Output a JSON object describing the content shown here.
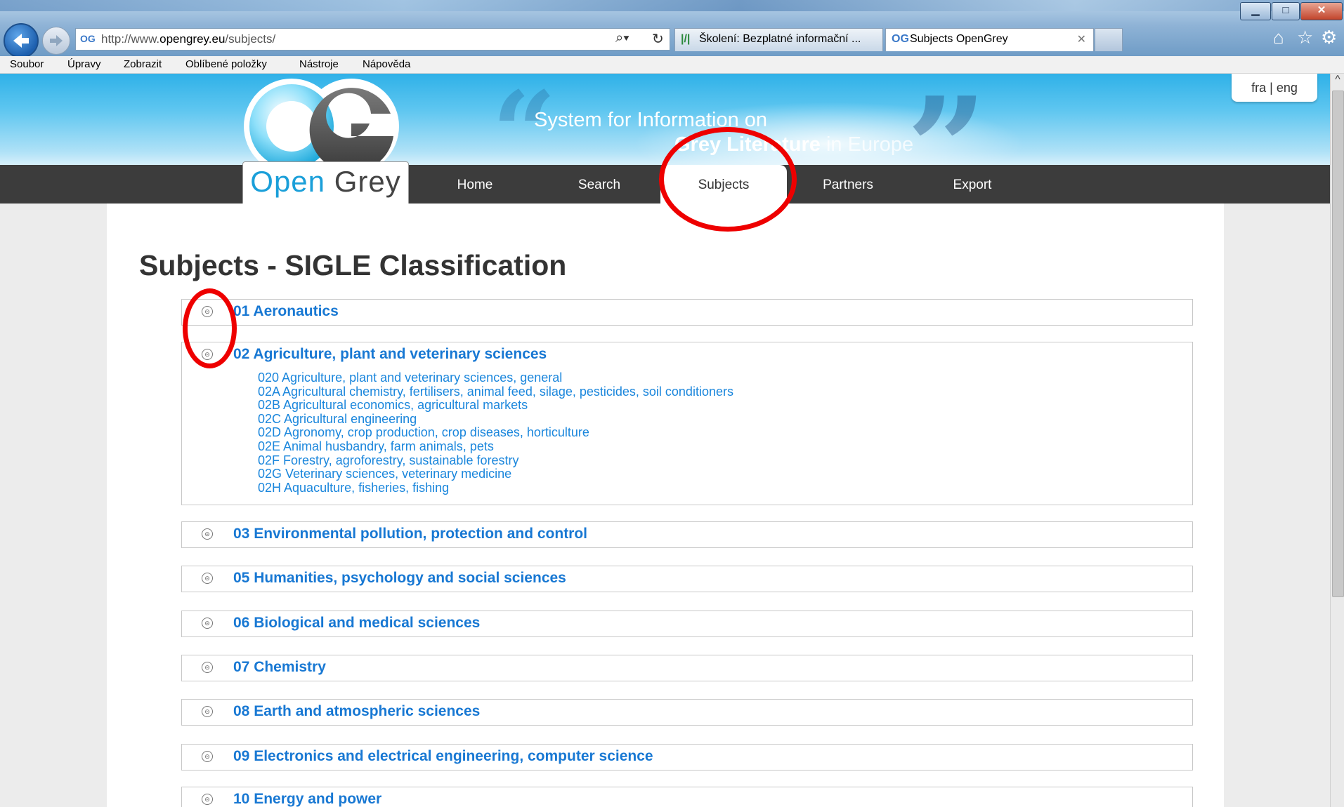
{
  "browser": {
    "url_prefix": "http://www.",
    "url_domain": "opengrey.eu",
    "url_path": "/subjects/",
    "favicon_text": "OG",
    "tabs": [
      {
        "icon": "|/|",
        "label": "Školení: Bezplatné informační ..."
      },
      {
        "icon": "OG",
        "label": "Subjects OpenGrey"
      }
    ],
    "menu": [
      "Soubor",
      "Úpravy",
      "Zobrazit",
      "Oblíbené položky",
      "Nástroje",
      "Nápověda"
    ],
    "window_buttons": {
      "minimize": "▁",
      "maximize": "□",
      "close": "✕"
    }
  },
  "site": {
    "logo_text_open": "Open",
    "logo_text_grey": "Grey",
    "tagline_line1": "System for Information on",
    "tagline_line2_bold": "Grey Literature",
    "tagline_line2_rest": " in Europe",
    "language_switch": "fra | eng",
    "nav": [
      "Home",
      "Search",
      "Subjects",
      "Partners",
      "Export"
    ],
    "active_nav": "Subjects"
  },
  "page": {
    "title": "Subjects - SIGLE Classification",
    "subjects": [
      {
        "label": "01 Aeronautics",
        "expanded": false,
        "children": []
      },
      {
        "label": "02 Agriculture, plant and veterinary sciences",
        "expanded": true,
        "children": [
          "020 Agriculture, plant and veterinary sciences, general",
          "02A Agricultural chemistry, fertilisers, animal feed, silage, pesticides, soil conditioners",
          "02B Agricultural economics, agricultural markets",
          "02C Agricultural engineering",
          "02D Agronomy, crop production, crop diseases, horticulture",
          "02E Animal husbandry, farm animals, pets",
          "02F Forestry, agroforestry, sustainable forestry",
          "02G Veterinary sciences, veterinary medicine",
          "02H Aquaculture, fisheries, fishing"
        ]
      },
      {
        "label": "03 Environmental pollution, protection and control",
        "expanded": false,
        "children": []
      },
      {
        "label": "05 Humanities, psychology and social sciences",
        "expanded": false,
        "children": []
      },
      {
        "label": "06 Biological and medical sciences",
        "expanded": false,
        "children": []
      },
      {
        "label": "07 Chemistry",
        "expanded": false,
        "children": []
      },
      {
        "label": "08 Earth and atmospheric sciences",
        "expanded": false,
        "children": []
      },
      {
        "label": "09 Electronics and electrical engineering, computer science",
        "expanded": false,
        "children": []
      },
      {
        "label": "10 Energy and power",
        "expanded": false,
        "children": []
      }
    ],
    "toggle_glyph": "⊝"
  },
  "colors": {
    "link": "#1878d3",
    "annotation": "#ee0000",
    "navbar": "#3c3c3c"
  }
}
